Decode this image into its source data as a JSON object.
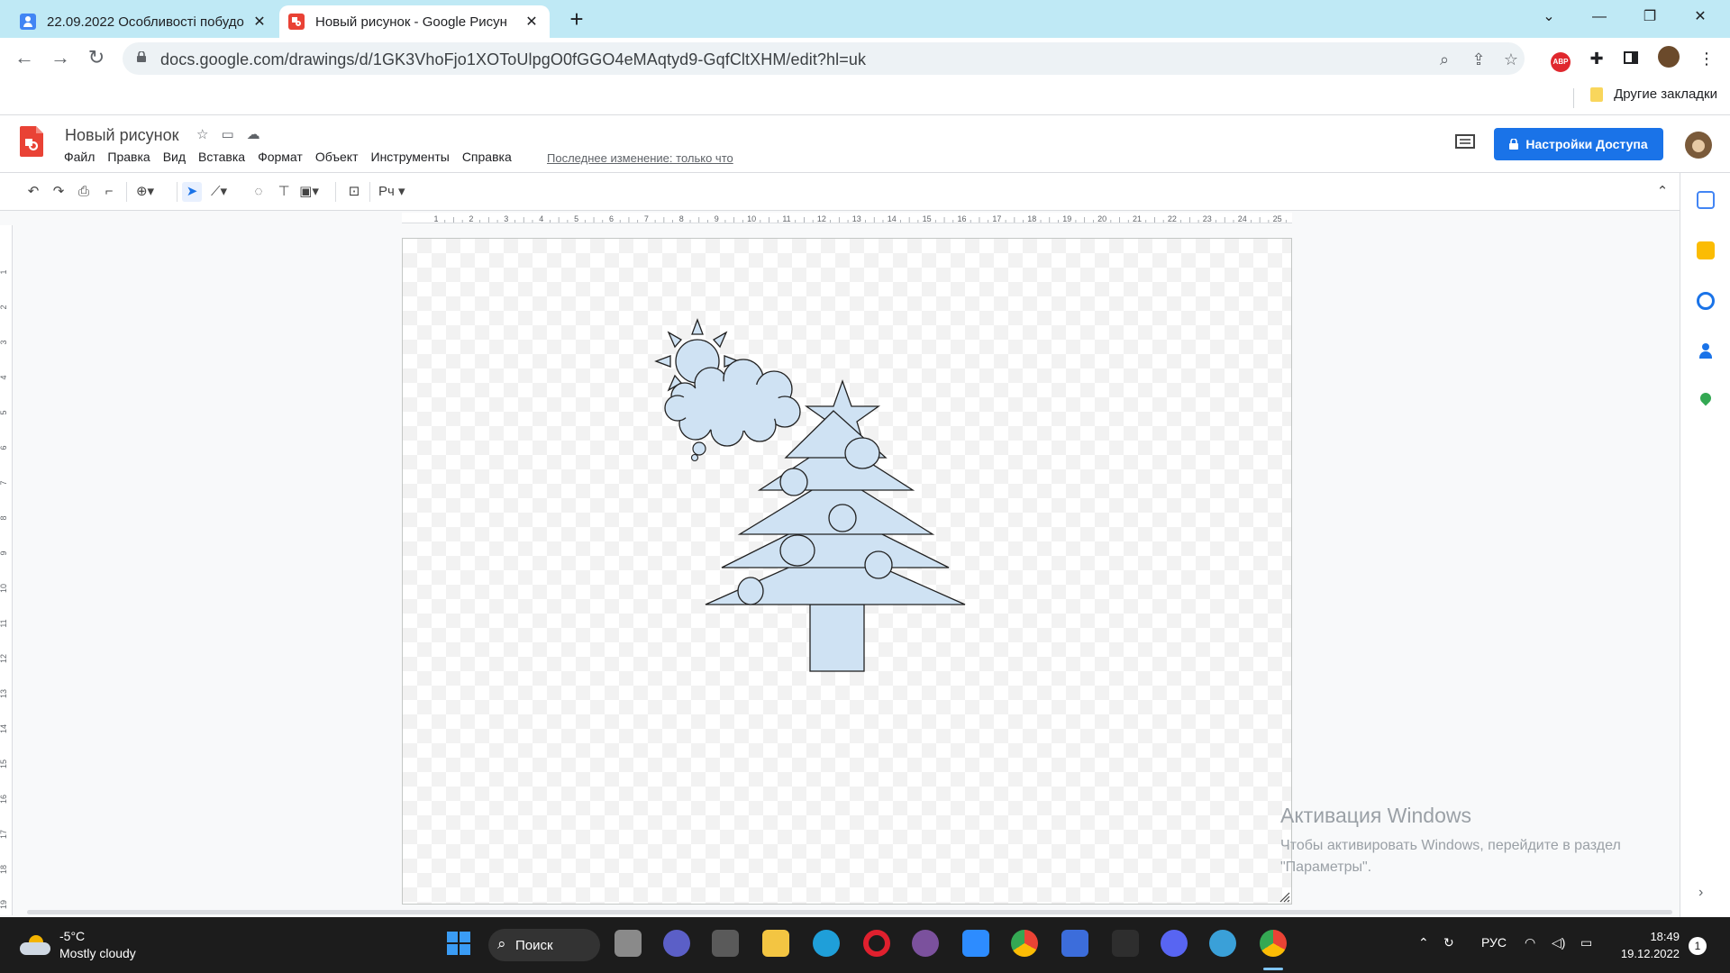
{
  "browser": {
    "tabs": [
      {
        "title": "22.09.2022 Особливості побудо",
        "close": "✕",
        "active": false
      },
      {
        "title": "Новый рисунок - Google Рисун",
        "close": "✕",
        "active": true
      }
    ],
    "new_tab": "+",
    "url": "docs.google.com/drawings/d/1GK3VhoFjo1XOToUlpgO0fGGO4eMAqtyd9-GqfCltXHM/edit?hl=uk",
    "bookmarks_other": "Другие закладки",
    "ext_abp": "ABP"
  },
  "app": {
    "doc_title": "Новый рисунок",
    "menu": [
      "Файл",
      "Правка",
      "Вид",
      "Вставка",
      "Формат",
      "Объект",
      "Инструменты",
      "Справка"
    ],
    "last_edit": "Последнее изменение: только что",
    "share_label": "Настройки Доступа",
    "font_button": "Рч"
  },
  "ruler": {
    "h_ticks": [
      "1",
      "2",
      "3",
      "4",
      "5",
      "6",
      "7",
      "8",
      "9",
      "10",
      "11",
      "12",
      "13",
      "14",
      "15",
      "16",
      "17",
      "18",
      "19",
      "20",
      "21",
      "22",
      "23",
      "24",
      "25"
    ],
    "v_ticks": [
      "1",
      "2",
      "3",
      "4",
      "5",
      "6",
      "7",
      "8",
      "9",
      "10",
      "11",
      "12",
      "13",
      "14",
      "15",
      "16",
      "17",
      "18",
      "19"
    ]
  },
  "watermark": {
    "title": "Активация Windows",
    "line1": "Чтобы активировать Windows, перейдите в раздел",
    "line2": "\"Параметры\"."
  },
  "taskbar": {
    "weather_temp": "-5°C",
    "weather_desc": "Mostly cloudy",
    "search_label": "Поиск",
    "lang": "РУС",
    "time": "18:49",
    "date": "19.12.2022",
    "notifications": "1"
  },
  "colors": {
    "shape_fill": "#cfe2f3",
    "accent": "#1a73e8",
    "tabstrip": "#bfe9f5"
  }
}
